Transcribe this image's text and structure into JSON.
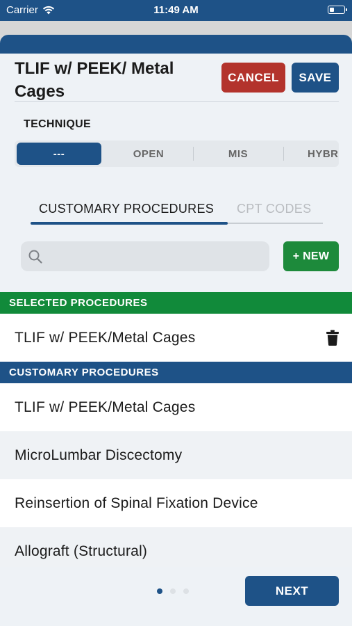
{
  "status_bar": {
    "carrier": "Carrier",
    "time": "11:49 AM"
  },
  "header": {
    "title": "TLIF w/ PEEK/ Metal Cages",
    "cancel_label": "CANCEL",
    "save_label": "SAVE"
  },
  "technique": {
    "label": "TECHNIQUE",
    "options": [
      "---",
      "OPEN",
      "MIS",
      "HYBR"
    ],
    "selected_index": 0
  },
  "tabs": [
    {
      "label": "CUSTOMARY PROCEDURES",
      "active": true
    },
    {
      "label": "CPT CODES",
      "active": false
    }
  ],
  "search": {
    "placeholder": ""
  },
  "new_button_label": "+ NEW",
  "selected_section": {
    "header": "SELECTED PROCEDURES",
    "items": [
      "TLIF w/ PEEK/Metal Cages"
    ]
  },
  "customary_section": {
    "header": "CUSTOMARY PROCEDURES",
    "items": [
      "TLIF w/ PEEK/Metal Cages",
      "MicroLumbar Discectomy",
      "Reinsertion of Spinal Fixation Device",
      "Allograft (Structural)"
    ]
  },
  "pagination": {
    "total": 3,
    "current": 1
  },
  "next_label": "NEXT",
  "colors": {
    "primary": "#1e5287",
    "danger": "#b3332c",
    "success": "#118a3a"
  }
}
